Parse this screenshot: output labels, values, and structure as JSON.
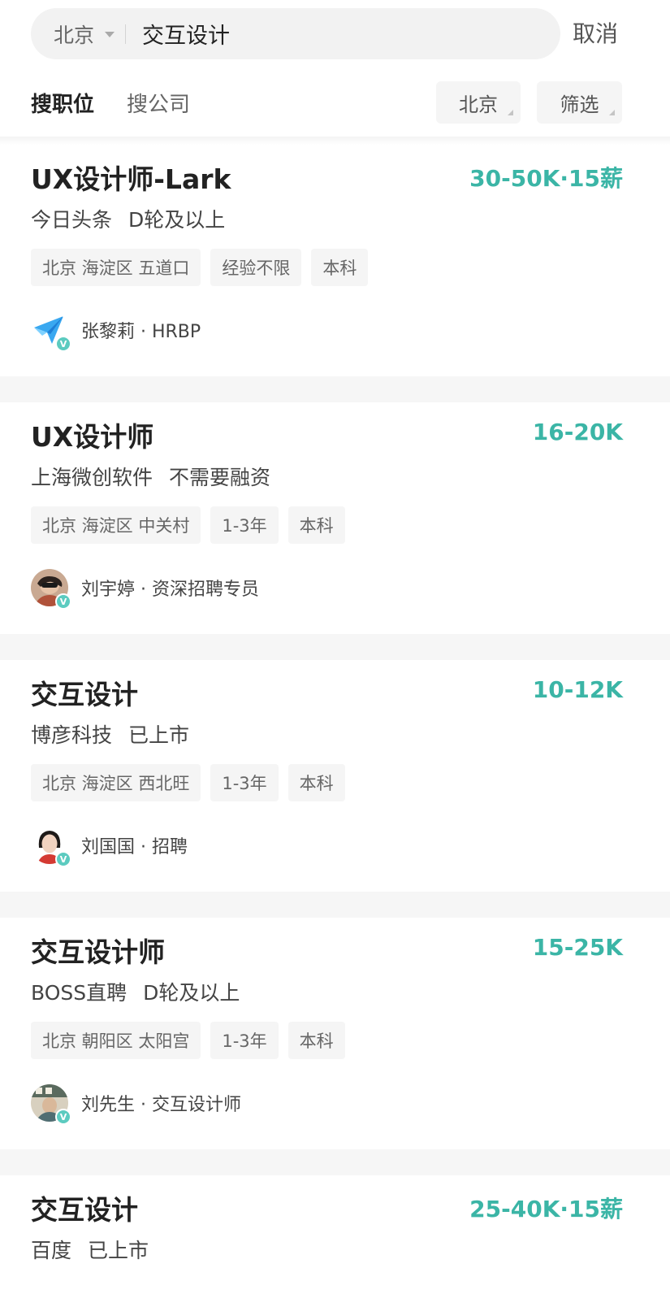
{
  "search": {
    "city": "北京",
    "query": "交互设计",
    "cancel_label": "取消"
  },
  "tabs": [
    {
      "label": "搜职位",
      "active": true
    },
    {
      "label": "搜公司",
      "active": false
    }
  ],
  "filters": {
    "city": "北京",
    "filter": "筛选"
  },
  "jobs": [
    {
      "title": "UX设计师-Lark",
      "salary": "30-50K·15薪",
      "company": "今日头条",
      "stage": "D轮及以上",
      "tags": [
        "北京 海淀区 五道口",
        "经验不限",
        "本科"
      ],
      "recruiter": "张黎莉 · HRBP",
      "avatar_icon": "lark-logo-icon"
    },
    {
      "title": "UX设计师",
      "salary": "16-20K",
      "company": "上海微创软件",
      "stage": "不需要融资",
      "tags": [
        "北京 海淀区 中关村",
        "1-3年",
        "本科"
      ],
      "recruiter": "刘宇婷 · 资深招聘专员",
      "avatar_icon": "user-photo-icon"
    },
    {
      "title": "交互设计",
      "salary": "10-12K",
      "company": "博彦科技",
      "stage": "已上市",
      "tags": [
        "北京 海淀区 西北旺",
        "1-3年",
        "本科"
      ],
      "recruiter": "刘国国 · 招聘",
      "avatar_icon": "user-photo-icon"
    },
    {
      "title": "交互设计师",
      "salary": "15-25K",
      "company": "BOSS直聘",
      "stage": "D轮及以上",
      "tags": [
        "北京 朝阳区 太阳宫",
        "1-3年",
        "本科"
      ],
      "recruiter": "刘先生 · 交互设计师",
      "avatar_icon": "user-photo-icon"
    },
    {
      "title": "交互设计",
      "salary": "25-40K·15薪",
      "company": "百度",
      "stage": "已上市"
    }
  ],
  "colors": {
    "salary": "#3bb5a6",
    "verified_badge": "#5ccbc0",
    "tag_bg": "#f5f5f5"
  }
}
